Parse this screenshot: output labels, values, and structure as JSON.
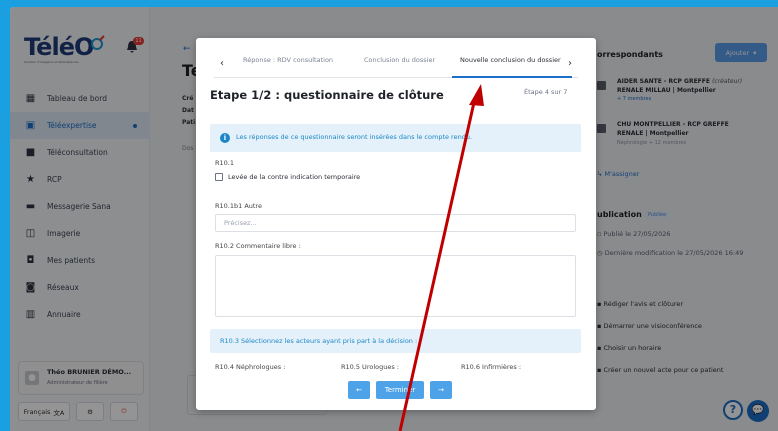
{
  "sidebar": {
    "logo": "TéléO",
    "logo_sub": "Solution d'imagerie et télémédecine",
    "bell_badge": "11",
    "items": [
      {
        "label": "Tableau de bord",
        "icon": "dashboard-icon"
      },
      {
        "label": "Téléexpertise",
        "icon": "teleexpertise-icon",
        "active": true
      },
      {
        "label": "Téléconsultation",
        "icon": "video-icon"
      },
      {
        "label": "RCP",
        "icon": "star-icon"
      },
      {
        "label": "Messagerie Sana",
        "icon": "message-icon"
      },
      {
        "label": "Imagerie",
        "icon": "image-icon"
      },
      {
        "label": "Mes patients",
        "icon": "patients-icon"
      },
      {
        "label": "Réseaux",
        "icon": "network-icon"
      },
      {
        "label": "Annuaire",
        "icon": "directory-icon"
      }
    ],
    "user": {
      "name": "Théo BRUNIER DÉMO...",
      "role": "Administrateur de filière"
    },
    "language": "Français",
    "lang_icon": "文A"
  },
  "background": {
    "back_arrow": "←",
    "title": "Te",
    "lines": [
      "Cré",
      "Dat",
      "Pati"
    ],
    "dos": "Dos"
  },
  "right_panel": {
    "title": "orrespondants",
    "add_button": "Ajouter",
    "correspondants": [
      {
        "name": "AIDER SANTE - RCP GREFFE",
        "tag": "(créateur)",
        "name2": "RENALE MILLAU | Montpellier",
        "sub": "+ 7 membres"
      },
      {
        "name": "CHU MONTPELLIER - RCP GREFFE",
        "name2": "RENALE | Montpellier",
        "sub": "Néphrologie + 12 membres"
      }
    ],
    "assign": "M'assigner",
    "publication": {
      "title": "ublication",
      "badge": "Publiée",
      "published": "Publié le 27/05/2026",
      "modified": "Dernière modification le 27/05/2026 16:49"
    },
    "actions": [
      "Rédiger l'avis et clôturer",
      "Démarrer une visioconférence",
      "Choisir un horaire",
      "Créer un nouvel acte pour ce patient"
    ]
  },
  "modal": {
    "tabs": [
      "Réponse : RDV consultation",
      "Conclusion du dossier",
      "Nouvelle conclusion du dossier"
    ],
    "active_tab": 2,
    "title": "Etape 1/2 : questionnaire de clôture",
    "step": "Étape 4 sur 7",
    "info": "Les réponses de ce questionnaire seront insérées dans le compte rendu.",
    "q1_code": "R10.1",
    "q1_checkbox": "Levée de la contre indication temporaire",
    "q2_label": "R10.1b1 Autre",
    "q2_placeholder": "Précisez...",
    "q3_label": "R10.2 Commentaire libre :",
    "select_title": "R10.3 Sélectionnez les acteurs ayant pris part à la décision :",
    "cols": [
      "R10.4 Néphrologues :",
      "R10.5 Urologues :",
      "R10.6 Infirmières :"
    ],
    "prev": "←",
    "finish": "Terminer",
    "next": "→"
  },
  "colors": {
    "accent": "#1d6fc7",
    "info_bg": "#e4f1fa",
    "arrow": "#c00000"
  }
}
